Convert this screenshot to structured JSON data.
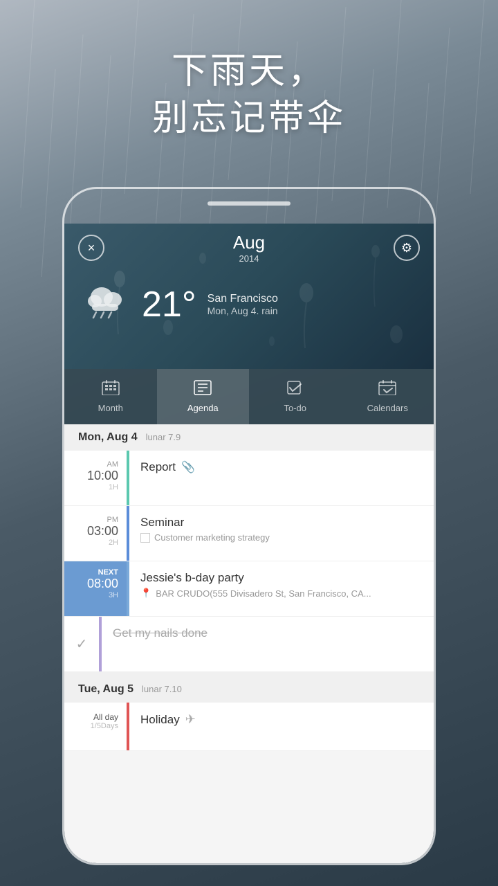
{
  "background": {
    "description": "Rainy day background scene"
  },
  "chinese_text": {
    "line1": "下雨天，",
    "line2": "别忘记带伞"
  },
  "header": {
    "close_label": "×",
    "month": "Aug",
    "year": "2014",
    "settings_icon": "⚙"
  },
  "weather": {
    "icon": "cloud-rain",
    "temperature": "21°",
    "city": "San Francisco",
    "description": "Mon, Aug 4.  rain"
  },
  "nav_tabs": [
    {
      "id": "month",
      "label": "Month",
      "icon": "month-grid"
    },
    {
      "id": "agenda",
      "label": "Agenda",
      "icon": "agenda-list",
      "active": true
    },
    {
      "id": "todo",
      "label": "To-do",
      "icon": "checkbox"
    },
    {
      "id": "calendars",
      "label": "Calendars",
      "icon": "calendar-check"
    }
  ],
  "day_sections": [
    {
      "date_label": "Mon, Aug 4",
      "lunar": "lunar 7.9",
      "events": [
        {
          "type": "event",
          "ampm": "AM",
          "time": "10:00",
          "duration": "1H",
          "indicator_color": "#5bc8af",
          "title": "Report",
          "has_attachment": true,
          "subtitle": null,
          "highlight": false
        },
        {
          "type": "event",
          "ampm": "PM",
          "time": "03:00",
          "duration": "2H",
          "indicator_color": "#5b8dd9",
          "title": "Seminar",
          "has_attachment": false,
          "subtitle": "Customer marketing strategy",
          "subtitle_icon": "checkbox-empty",
          "highlight": false
        },
        {
          "type": "event",
          "next_label": "NEXT",
          "time": "08:00",
          "duration": "3H",
          "indicator_color": "#6b9bd2",
          "title": "Jessie's b-day party",
          "has_attachment": false,
          "subtitle": "BAR CRUDO(555 Divisadero St, San Francisco, CA...",
          "subtitle_icon": "location",
          "highlight": true
        },
        {
          "type": "todo",
          "title": "Get my nails done",
          "done": true,
          "indicator_color": "#9b8dd2"
        }
      ]
    },
    {
      "date_label": "Tue, Aug 5",
      "lunar": "lunar 7.10",
      "events": [
        {
          "type": "allday",
          "allday_label": "All day",
          "allday_days": "1/5Days",
          "indicator_color": "#e05555",
          "title": "Holiday",
          "has_plane_icon": true
        }
      ]
    }
  ]
}
